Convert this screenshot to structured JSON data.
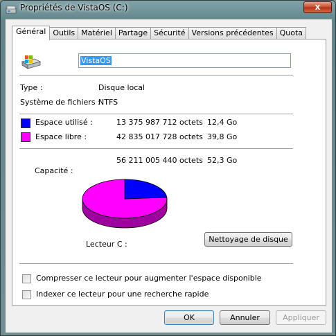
{
  "window": {
    "title": "Propriétés de VistaOS (C:)",
    "close_glyph": "x"
  },
  "tabs": [
    {
      "label": "Général",
      "active": true
    },
    {
      "label": "Outils"
    },
    {
      "label": "Matériel"
    },
    {
      "label": "Partage"
    },
    {
      "label": "Sécurité"
    },
    {
      "label": "Versions précédentes"
    },
    {
      "label": "Quota"
    }
  ],
  "drive": {
    "name": "VistaOS",
    "icon": "drive-icon"
  },
  "info": {
    "type_label": "Type :",
    "type_value": "Disque local",
    "fs_label": "Système de fichiers :",
    "fs_value": "NTFS"
  },
  "space": {
    "used_label": "Espace utilisé :",
    "used_bytes": "13 375 987 712 octets",
    "used_short": "12,4 Go",
    "free_label": "Espace libre :",
    "free_bytes": "42 835 017 728 octets",
    "free_short": "39,8 Go",
    "capacity_label": "Capacité :",
    "capacity_bytes": "56 211 005 440 octets",
    "capacity_short": "52,3 Go",
    "used_color": "#0000ff",
    "free_color": "#ff00ff",
    "used_fraction": 0.238
  },
  "drive_label": "Lecteur C :",
  "cleanup_button": "Nettoyage de disque",
  "options": {
    "compress": {
      "label": "Compresser ce lecteur pour augmenter l'espace disponible",
      "checked": false
    },
    "index": {
      "label": "Indexer ce lecteur pour une recherche rapide",
      "checked": false
    }
  },
  "buttons": {
    "ok": "OK",
    "cancel": "Annuler",
    "apply": "Appliquer"
  }
}
